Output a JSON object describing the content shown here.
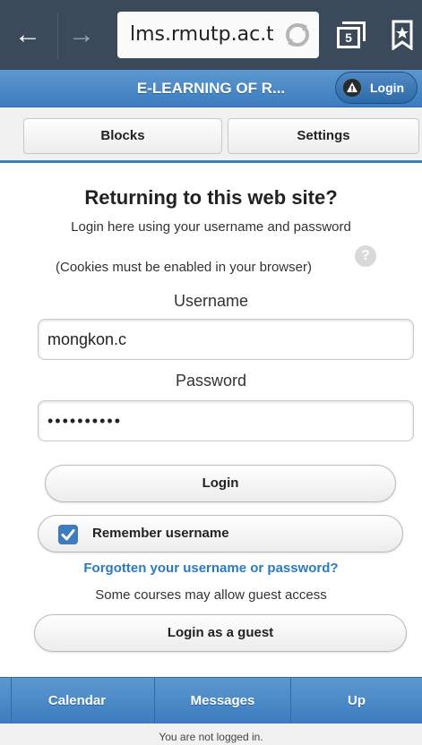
{
  "browser": {
    "url": "lms.rmutp.ac.th/l",
    "tab_count": "5"
  },
  "header": {
    "title": "E-LEARNING OF R...",
    "login_label": "Login"
  },
  "subnav": {
    "blocks_label": "Blocks",
    "settings_label": "Settings"
  },
  "login_form": {
    "heading": "Returning to this web site?",
    "instructions": "Login here using your username and password",
    "cookies_note": "(Cookies must be enabled in your browser)",
    "help_glyph": "?",
    "username_label": "Username",
    "username_value": "mongkon.c",
    "password_label": "Password",
    "password_value": "••••••••••",
    "login_button": "Login",
    "remember_label": "Remember username",
    "remember_checked": true,
    "forgot_link": "Forgotten your username or password?",
    "guest_note": "Some courses may allow guest access",
    "guest_button": "Login as a guest"
  },
  "footer": {
    "items": [
      {
        "label": "Calendar"
      },
      {
        "label": "Messages"
      },
      {
        "label": "Up"
      }
    ],
    "status": "You are not logged in."
  },
  "colors": {
    "chrome": "#3b4a5a",
    "accent": "#3c7cbf",
    "link": "#2a7ac0"
  },
  "icons": [
    "back-arrow-icon",
    "forward-arrow-icon",
    "reload-icon",
    "tabs-icon",
    "bookmark-icon",
    "alert-icon",
    "help-icon",
    "checkbox-checked-icon"
  ]
}
